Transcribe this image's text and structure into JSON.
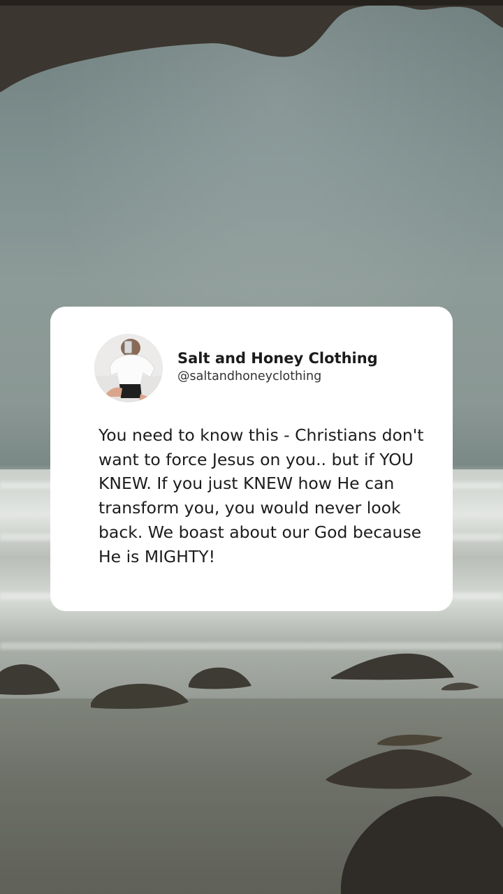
{
  "post": {
    "author_name": "Salt and Honey Clothing",
    "author_handle": "@saltandhoneyclothing",
    "avatar": "profile-photo",
    "text": "You need to know this - Christians don't want to force Jesus on you.. but if YOU KNEW. If you just KNEW how He can transform you, you would never look back. We boast about our God because He is MIGHTY!"
  },
  "background": {
    "scene": "beach-cave-ocean-photo",
    "colors": {
      "sky": "#7f908f",
      "sea": "#d7dbd6",
      "sand": "#6e7168",
      "rock": "#3a3630",
      "card": "#ffffff"
    }
  }
}
